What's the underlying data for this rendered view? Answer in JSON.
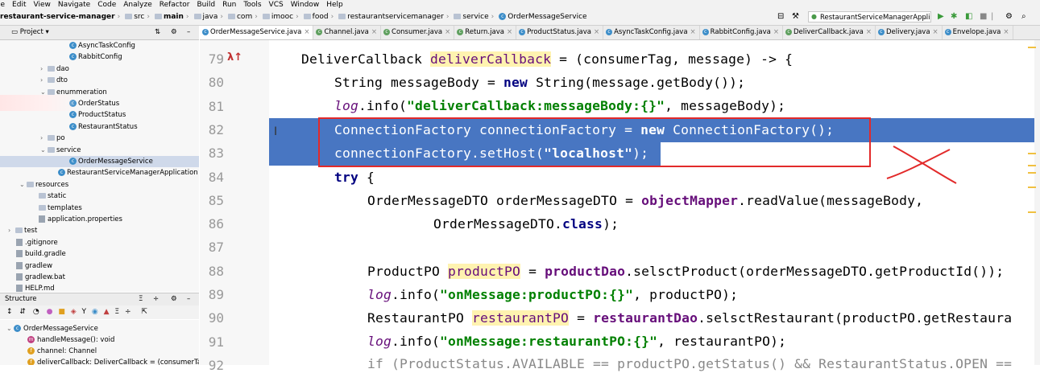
{
  "menu": [
    "le",
    "Edit",
    "View",
    "Navigate",
    "Code",
    "Analyze",
    "Refactor",
    "Build",
    "Run",
    "Tools",
    "VCS",
    "Window",
    "Help"
  ],
  "breadcrumb": [
    "restaurant-service-manager",
    "src",
    "main",
    "java",
    "com",
    "imooc",
    "food",
    "restaurantservicemanager",
    "service",
    "OrderMessageService"
  ],
  "run_config": "RestaurantServiceManagerApplication",
  "tabs": [
    "OrderMessageService.java",
    "Channel.java",
    "Consumer.java",
    "Return.java",
    "ProductStatus.java",
    "AsyncTaskConfig.java",
    "RabbitConfig.java",
    "DeliverCallback.java",
    "Delivery.java",
    "Envelope.java"
  ],
  "project_panel": {
    "title": "Project",
    "dropdown": "▾"
  },
  "tree": [
    {
      "label": "AsyncTaskConfig",
      "type": "class"
    },
    {
      "label": "RabbitConfig",
      "type": "class"
    },
    {
      "label": "dao",
      "type": "folder"
    },
    {
      "label": "dto",
      "type": "folder"
    },
    {
      "label": "enummeration",
      "type": "folder"
    },
    {
      "label": "OrderStatus",
      "type": "class"
    },
    {
      "label": "ProductStatus",
      "type": "class"
    },
    {
      "label": "RestaurantStatus",
      "type": "class"
    },
    {
      "label": "po",
      "type": "folder"
    },
    {
      "label": "service",
      "type": "folder"
    },
    {
      "label": "OrderMessageService",
      "type": "class"
    },
    {
      "label": "RestaurantServiceManagerApplication",
      "type": "class"
    },
    {
      "label": "resources",
      "type": "folder"
    },
    {
      "label": "static",
      "type": "folder"
    },
    {
      "label": "templates",
      "type": "folder"
    },
    {
      "label": "application.properties",
      "type": "file"
    },
    {
      "label": "test",
      "type": "folder"
    },
    {
      "label": ".gitignore",
      "type": "file"
    },
    {
      "label": "build.gradle",
      "type": "file"
    },
    {
      "label": "gradlew",
      "type": "file"
    },
    {
      "label": "gradlew.bat",
      "type": "file"
    },
    {
      "label": "HELP.md",
      "type": "file"
    }
  ],
  "structure_panel": {
    "title": "Structure",
    "items": [
      {
        "label": "OrderMessageService",
        "kind": "class"
      },
      {
        "label": "handleMessage(): void",
        "kind": "method"
      },
      {
        "label": "channel: Channel",
        "kind": "field"
      },
      {
        "label": "deliverCallback: DeliverCallback = (consumerTa",
        "kind": "field"
      }
    ]
  },
  "line_numbers": [
    "79",
    "80",
    "81",
    "82",
    "83",
    "84",
    "85",
    "86",
    "87",
    "88",
    "89",
    "90",
    "91",
    "92"
  ],
  "code": {
    "l79a": "DeliverCallback ",
    "l79b": "deliverCallback",
    "l79c": " = (consumerTag, message) -> {",
    "l80a": "String messageBody = ",
    "l80b": "new",
    "l80c": " String(message.getBody());",
    "l81a": "log",
    "l81b": ".info(",
    "l81c": "\"deliverCallback:messageBody:{}\"",
    "l81d": ", messageBody);",
    "l82a": "ConnectionFactory connectionFactory = ",
    "l82b": "new",
    "l82c": " ConnectionFactory();",
    "l83a": "connectionFactory.setHost(",
    "l83b": "\"localhost\"",
    "l83c": ");",
    "l84": "try",
    "l84b": " {",
    "l85a": "OrderMessageDTO orderMessageDTO = ",
    "l85b": "objectMapper",
    "l85c": ".readValue(messageBody,",
    "l86a": "OrderMessageDTO.",
    "l86b": "class",
    "l86c": ");",
    "l88a": "ProductPO ",
    "l88b": "productPO",
    "l88c": " = ",
    "l88d": "productDao",
    "l88e": ".selsctProduct(orderMessageDTO.getProductId());",
    "l89a": "log",
    "l89b": ".info(",
    "l89c": "\"onMessage:productPO:{}\"",
    "l89d": ", productPO);",
    "l90a": "RestaurantPO ",
    "l90b": "restaurantPO",
    "l90c": " = ",
    "l90d": "restaurantDao",
    "l90e": ".selsctRestaurant(productPO.getRestaura",
    "l91a": "log",
    "l91b": ".info(",
    "l91c": "\"onMessage:restaurantPO:{}\"",
    "l91d": ", restaurantPO);",
    "l92": "if (ProductStatus.AVAILABLE == productPO.getStatus() && RestaurantStatus.OPEN =="
  },
  "gutter_mark": "λ↑",
  "colors": {
    "selection": "#4876c2",
    "annotation": "#e22a2a",
    "keyword": "#000080",
    "string": "#008000",
    "field": "#660e7a"
  }
}
